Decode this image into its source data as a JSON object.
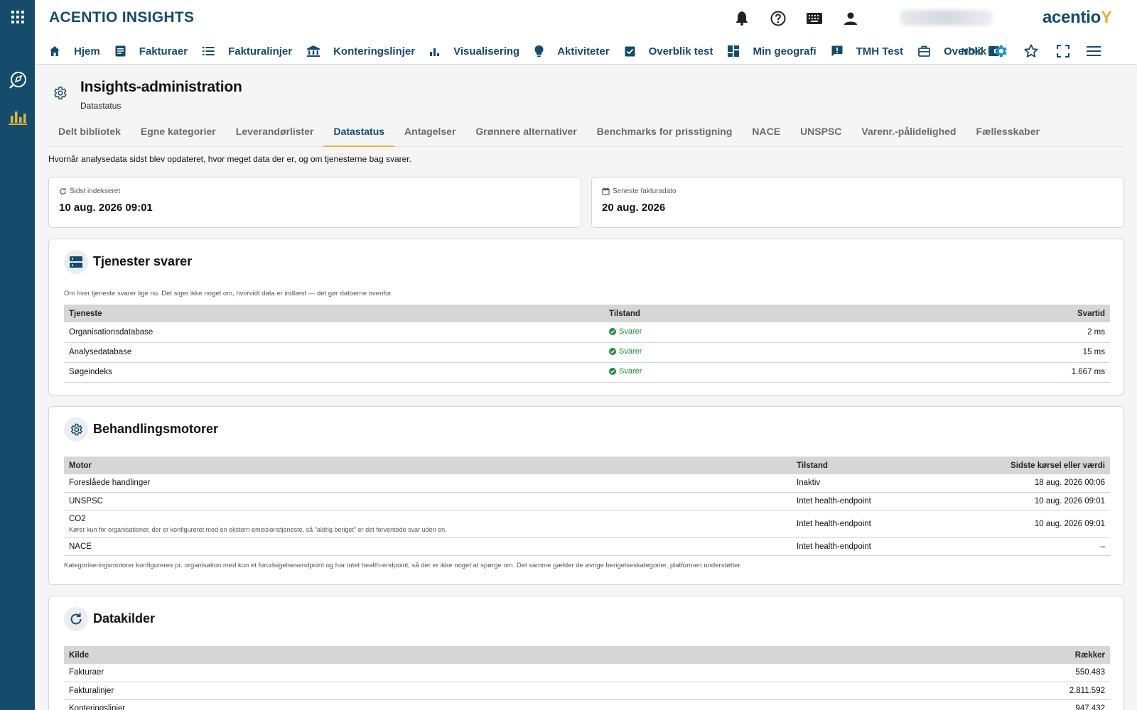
{
  "app": {
    "title": "ACENTIO INSIGHTS",
    "logo_text": "acentio",
    "user_name": "Navn Nyborg"
  },
  "nav": {
    "items": [
      {
        "label": "Hjem",
        "icon": "home-icon"
      },
      {
        "label": "Fakturaer",
        "icon": "invoice-icon"
      },
      {
        "label": "Fakturalinjer",
        "icon": "list-icon"
      },
      {
        "label": "Konteringslinjer",
        "icon": "bank-icon"
      },
      {
        "label": "Visualisering",
        "icon": "bar-chart-icon"
      },
      {
        "label": "Aktiviteter",
        "icon": "lightbulb-icon"
      },
      {
        "label": "Overblik test",
        "icon": "check-clipboard-icon"
      },
      {
        "label": "Min geografi",
        "icon": "dashboard-icon"
      },
      {
        "label": "TMH Test",
        "icon": "feedback-icon"
      },
      {
        "label": "Overblik",
        "icon": "briefcase-icon"
      }
    ],
    "currency": "NOK"
  },
  "page": {
    "title": "Insights-administration",
    "subtitle": "Datastatus",
    "intro": "Hvornår analysedata sidst blev opdateret, hvor meget data der er, og om tjenesterne bag svarer."
  },
  "tabs": [
    {
      "label": "Delt bibliotek",
      "active": false
    },
    {
      "label": "Egne kategorier",
      "active": false
    },
    {
      "label": "Leverandørlister",
      "active": false
    },
    {
      "label": "Datastatus",
      "active": true
    },
    {
      "label": "Antagelser",
      "active": false
    },
    {
      "label": "Grønnere alternativer",
      "active": false
    },
    {
      "label": "Benchmarks for prisstigning",
      "active": false
    },
    {
      "label": "NACE",
      "active": false
    },
    {
      "label": "UNSPSC",
      "active": false
    },
    {
      "label": "Varenr.-pålidelighed",
      "active": false
    },
    {
      "label": "Fællesskaber",
      "active": false
    }
  ],
  "stats": {
    "indexed": {
      "label": "Sidst indekseret",
      "value": "10 aug. 2026 09:01"
    },
    "invoice": {
      "label": "Seneste fakturadato",
      "value": "20 aug. 2026"
    }
  },
  "services": {
    "title": "Tjenester svarer",
    "note": "Om hver tjeneste svarer lige nu. Det siger ikke noget om, hvorvidt data er indlæst — det gør datoerne ovenfor.",
    "headers": [
      "Tjeneste",
      "Tilstand",
      "Svartid"
    ],
    "rows": [
      {
        "name": "Organisationsdatabase",
        "status": "Svarer",
        "time": "2 ms"
      },
      {
        "name": "Analysedatabase",
        "status": "Svarer",
        "time": "15 ms"
      },
      {
        "name": "Søgeindeks",
        "status": "Svarer",
        "time": "1.667 ms"
      }
    ]
  },
  "engines": {
    "title": "Behandlingsmotorer",
    "headers": [
      "Motor",
      "Tilstand",
      "Sidste kørsel eller værdi"
    ],
    "rows": [
      {
        "name": "Foreslåede handlinger",
        "status": "Inaktiv",
        "last": "18 aug. 2026 00:06",
        "note": ""
      },
      {
        "name": "UNSPSC",
        "status": "Intet health-endpoint",
        "last": "10 aug. 2026 09:01",
        "note": ""
      },
      {
        "name": "CO2",
        "status": "Intet health-endpoint",
        "last": "10 aug. 2026 09:01",
        "note": "Kører kun for organisationer, der er konfigureret med en ekstern emissionstjeneste, så \"aldrig beriget\" er det forventede svar uden en."
      },
      {
        "name": "NACE",
        "status": "Intet health-endpoint",
        "last": "–",
        "note": ""
      }
    ],
    "footnote": "Kategoriseringsmotorer konfigureres pr. organisation med kun et forudsigelsesendpoint og har intet health-endpoint, så der er ikke noget at spørge om. Det samme gælder de øvrige berigelseskategorier, platformen understøtter."
  },
  "sources": {
    "title": "Datakilder",
    "headers": [
      "Kilde",
      "Rækker"
    ],
    "rows": [
      {
        "name": "Fakturaer",
        "count": "550.483"
      },
      {
        "name": "Fakturalinjer",
        "count": "2.811.592"
      },
      {
        "name": "Konteringslinjer",
        "count": "947.432"
      }
    ]
  },
  "colors": {
    "brand": "#154b6b",
    "accent": "#e0b53a",
    "ok": "#1d8a3a",
    "settings_active": "#1c8fc7"
  }
}
